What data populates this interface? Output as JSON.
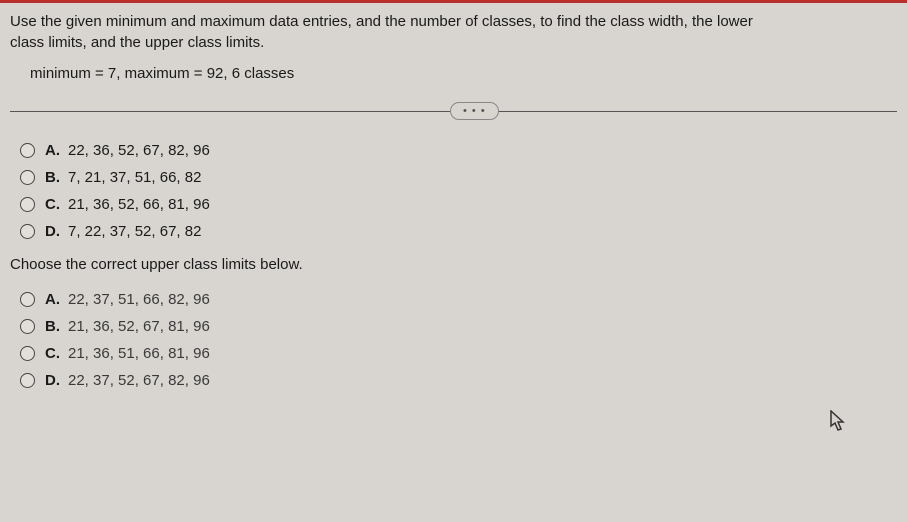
{
  "question": {
    "line1": "Use the given minimum and maximum data entries, and the number of classes, to find the class width, the lower",
    "line2": "class limits, and the upper class limits.",
    "params": "minimum = 7,  maximum = 92, 6 classes"
  },
  "ellipsis": "• • •",
  "group1": {
    "options": [
      {
        "label": "A.",
        "text": "22, 36, 52, 67, 82, 96"
      },
      {
        "label": "B.",
        "text": "7, 21, 37, 51, 66, 82"
      },
      {
        "label": "C.",
        "text": "21, 36, 52, 66, 81, 96"
      },
      {
        "label": "D.",
        "text": "7, 22, 37, 52, 67, 82"
      }
    ]
  },
  "sub_question": "Choose the correct upper class limits below.",
  "group2": {
    "options": [
      {
        "label": "A.",
        "text": "22, 37, 51, 66, 82, 96"
      },
      {
        "label": "B.",
        "text": "21, 36, 52, 67, 81, 96"
      },
      {
        "label": "C.",
        "text": "21, 36, 51, 66, 81, 96"
      },
      {
        "label": "D.",
        "text": "22, 37, 52, 67, 82, 96"
      }
    ]
  }
}
